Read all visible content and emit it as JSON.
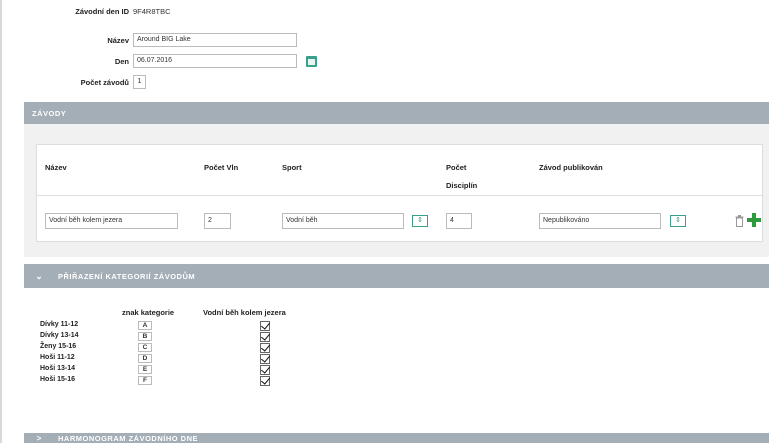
{
  "form": {
    "id_label": "Závodní den ID",
    "id_value": "9F4R8TBC",
    "name_label": "Název",
    "name_value": "Around BIG Lake",
    "day_label": "Den",
    "day_value": "06.07.2016",
    "count_label": "Počet závodů",
    "count_value": "1"
  },
  "races_section": {
    "title": "ZÁVODY",
    "columns": {
      "name": "Název",
      "waves": "Počet Vln",
      "sport": "Sport",
      "disc_line1": "Počet",
      "disc_line2": "Disciplín",
      "published": "Závod publikován"
    },
    "row": {
      "name": "Vodní běh kolem jezera",
      "waves": "2",
      "sport": "Vodní běh",
      "disciplines": "4",
      "published": "Nepublikováno"
    },
    "select_glyph": "⇕"
  },
  "categories_section": {
    "chevron": "⌄",
    "title": "PŘIŘAZENÍ KATEGORIÍ ZÁVODŮM",
    "col_code": "znak kategorie",
    "col_race": "Vodní běh kolem jezera",
    "rows": [
      {
        "name": "Dívky 11-12",
        "code": "A",
        "checked": true
      },
      {
        "name": "Dívky 13-14",
        "code": "B",
        "checked": true
      },
      {
        "name": "Ženy 15-16",
        "code": "C",
        "checked": true
      },
      {
        "name": "Hoši 11-12",
        "code": "D",
        "checked": true
      },
      {
        "name": "Hoši 13-14",
        "code": "E",
        "checked": true
      },
      {
        "name": "Hoši 15-16",
        "code": "F",
        "checked": true
      }
    ]
  },
  "bottom_section": {
    "chevron": ">",
    "title": "HARMONOGRAM ZÁVODNÍHO DNE"
  },
  "colors": {
    "section_bar": "#a4aeb6",
    "accent": "#3aa08c",
    "add": "#2e9a3e"
  }
}
